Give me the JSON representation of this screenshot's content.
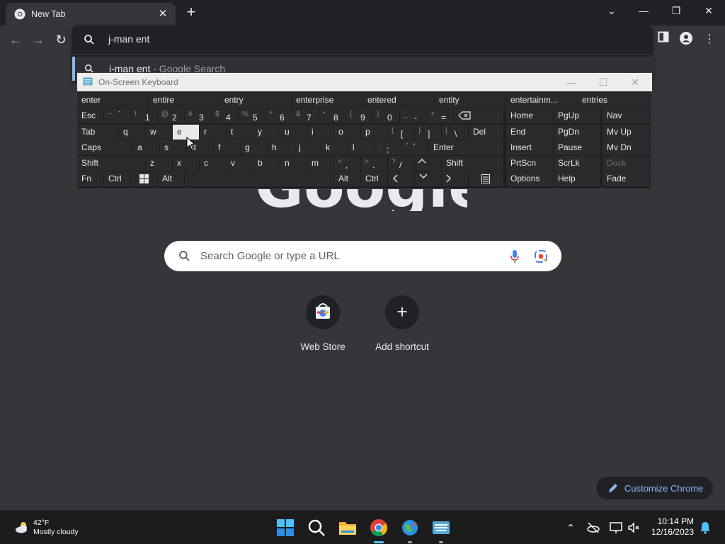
{
  "browser": {
    "tab_title": "New Tab",
    "address_text": "j-man ent",
    "suggestion_text": "j-man ent",
    "suggestion_sub": " - Google Search",
    "search_placeholder": "Search Google or type a URL",
    "logo_text": "Google",
    "shortcuts": [
      {
        "label": "Web Store",
        "icon": "web-store-icon"
      },
      {
        "label": "Add shortcut",
        "icon": "plus-icon"
      }
    ],
    "customize_label": "Customize Chrome",
    "accent_color": "#8ab4f8"
  },
  "osk": {
    "title": "On-Screen Keyboard",
    "predictions": [
      "enter",
      "entire",
      "entry",
      "enterprise",
      "entered",
      "entity",
      "entertainm...",
      "entries"
    ],
    "row1": {
      "esc": "Esc",
      "keys": [
        [
          "~",
          "`"
        ],
        [
          "!",
          "1"
        ],
        [
          "@",
          "2"
        ],
        [
          "#",
          "3"
        ],
        [
          "$",
          "4"
        ],
        [
          "%",
          "5"
        ],
        [
          "^",
          "6"
        ],
        [
          "&",
          "7"
        ],
        [
          "*",
          "8"
        ],
        [
          "(",
          "9"
        ],
        [
          ")",
          "0"
        ],
        [
          "_",
          "-"
        ],
        [
          "+",
          "="
        ]
      ]
    },
    "row2": {
      "tab": "Tab",
      "keys": [
        "q",
        "w",
        "e",
        "r",
        "t",
        "y",
        "u",
        "i",
        "o",
        "p"
      ],
      "sym": [
        [
          "{",
          "["
        ],
        [
          "}",
          "]"
        ],
        [
          "|",
          "\\"
        ]
      ],
      "del": "Del"
    },
    "row3": {
      "caps": "Caps",
      "keys": [
        "a",
        "s",
        "d",
        "f",
        "g",
        "h",
        "j",
        "k",
        "l"
      ],
      "sym": [
        [
          ":",
          ";"
        ],
        [
          "\"",
          "'"
        ]
      ],
      "enter": "Enter"
    },
    "row4": {
      "shift": "Shift",
      "keys": [
        "z",
        "x",
        "c",
        "v",
        "b",
        "n",
        "m"
      ],
      "sym": [
        [
          "<",
          ","
        ],
        [
          ">",
          "."
        ],
        [
          "?",
          "/"
        ]
      ],
      "shift_r": "Shift"
    },
    "row5": {
      "fn": "Fn",
      "ctrl": "Ctrl",
      "alt": "Alt",
      "alt_r": "Alt",
      "ctrl_r": "Ctrl"
    },
    "nav": [
      [
        "Home",
        "PgUp",
        "Nav"
      ],
      [
        "End",
        "PgDn",
        "Mv Up"
      ],
      [
        "Insert",
        "Pause",
        "Mv Dn"
      ],
      [
        "PrtScn",
        "ScrLk",
        "Dock"
      ],
      [
        "Options",
        "Help",
        "Fade"
      ]
    ]
  },
  "taskbar": {
    "weather_temp": "42°F",
    "weather_desc": "Mostly cloudy",
    "time": "10:14 PM",
    "date": "12/16/2023"
  }
}
